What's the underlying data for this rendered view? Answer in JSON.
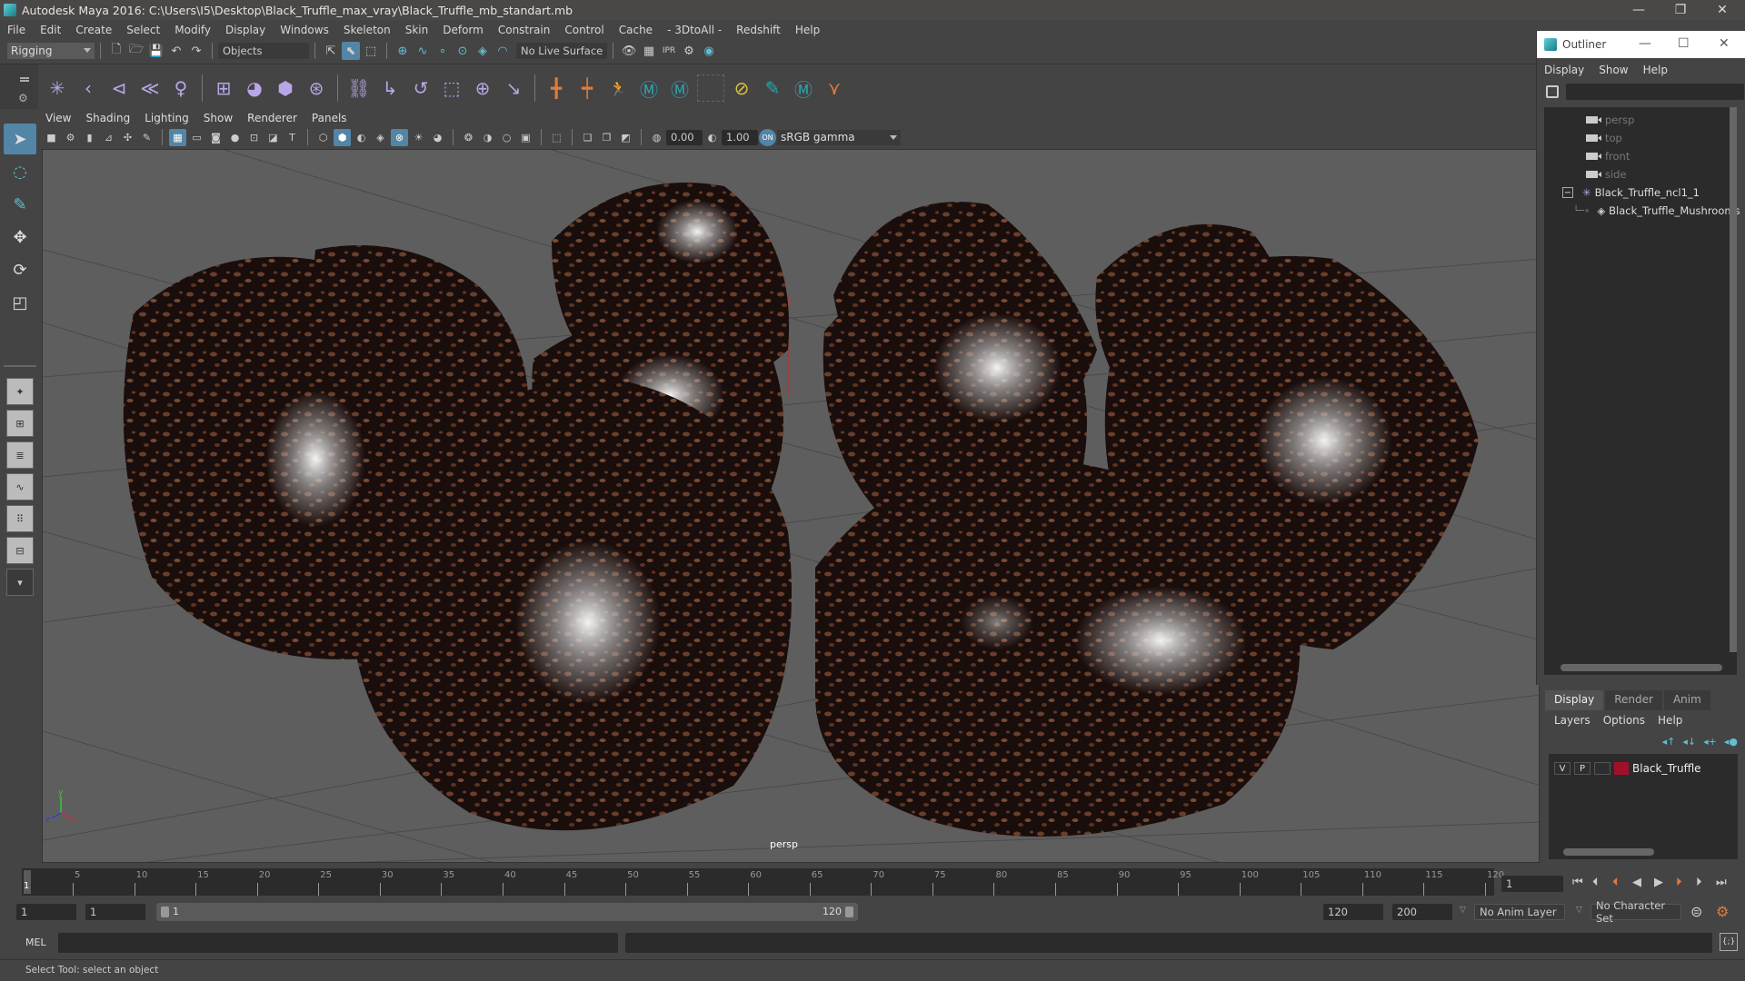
{
  "window": {
    "title": "Autodesk Maya 2016: C:\\Users\\I5\\Desktop\\Black_Truffle_max_vray\\Black_Truffle_mb_standart.mb",
    "controls": [
      "minimize",
      "restore",
      "close"
    ]
  },
  "menubar": [
    "File",
    "Edit",
    "Create",
    "Select",
    "Modify",
    "Display",
    "Windows",
    "Skeleton",
    "Skin",
    "Deform",
    "Constrain",
    "Control",
    "Cache",
    "- 3DtoAll -",
    "Redshift",
    "Help"
  ],
  "statusline": {
    "menuset": "Rigging",
    "selection_mode": "Objects",
    "live_surface": "No Live Surface"
  },
  "shelf": {
    "icons": [
      "joint-icon",
      "ik-handle-icon",
      "ik-spline-icon",
      "mirror-joint-icon",
      "humanik-icon",
      "bind-skin-icon",
      "smooth-bind-icon",
      "lattice-icon",
      "cluster-icon",
      "parent-constraint-icon",
      "point-constraint-icon",
      "orient-constraint-icon",
      "scale-constraint-icon",
      "aim-constraint-icon",
      "pole-vector-icon",
      "locator-icon",
      "locator-link-icon",
      "character-icon",
      "maya-icon-1",
      "maya-icon-2",
      "empty-slot",
      "delete-history-icon",
      "paint-weights-icon",
      "maya-icon-3",
      "vertex-icon"
    ]
  },
  "toolbox": {
    "tools": [
      "select-tool",
      "lasso-tool",
      "paint-select-tool",
      "move-tool",
      "rotate-tool",
      "scale-tool"
    ],
    "layouts": [
      "single-pane-layout",
      "four-pane-layout",
      "outliner-persp-layout",
      "graph-persp-layout",
      "hypershade-layout",
      "persp-graph-outliner-layout"
    ]
  },
  "viewport": {
    "menu": [
      "View",
      "Shading",
      "Lighting",
      "Show",
      "Renderer",
      "Panels"
    ],
    "exposure": "0.00",
    "gamma": "1.00",
    "color_space": "sRGB gamma",
    "camera": "persp",
    "axis": {
      "x": "x",
      "y": "y",
      "z": "z"
    }
  },
  "outliner": {
    "title": "Outliner",
    "menu": [
      "Display",
      "Show",
      "Help"
    ],
    "items": [
      {
        "label": "persp",
        "type": "camera",
        "dim": true
      },
      {
        "label": "top",
        "type": "camera",
        "dim": true
      },
      {
        "label": "front",
        "type": "camera",
        "dim": true
      },
      {
        "label": "side",
        "type": "camera",
        "dim": true
      },
      {
        "label": "Black_Truffle_ncl1_1",
        "type": "group",
        "expanded": true
      },
      {
        "label": "Black_Truffle_Mushrooms",
        "type": "mesh",
        "child": true
      }
    ]
  },
  "layer_editor": {
    "tabs": [
      "Display",
      "Render",
      "Anim"
    ],
    "active_tab": "Display",
    "menu": [
      "Layers",
      "Options",
      "Help"
    ],
    "layers": [
      {
        "visible": "V",
        "playback": "P",
        "name": "Black_Truffle",
        "color": "#a0102a"
      }
    ]
  },
  "timeline": {
    "ticks": [
      5,
      10,
      15,
      20,
      25,
      30,
      35,
      40,
      45,
      50,
      55,
      60,
      65,
      70,
      75,
      80,
      85,
      90,
      95,
      100,
      105,
      110,
      115,
      120
    ],
    "current_frame": "1",
    "frame_field": "1",
    "range_start": 1,
    "range_end": 120
  },
  "range": {
    "start_field": "1",
    "start_field2": "1",
    "slider_start": "1",
    "slider_end": "120",
    "end_field": "120",
    "end_field2": "200",
    "anim_layer": "No Anim Layer",
    "character_set": "No Character Set"
  },
  "cmdline": {
    "label": "MEL"
  },
  "helpline": {
    "text": "Select Tool: select an object"
  },
  "colors": {
    "accent": "#5285a6",
    "playback_marker": "#e07a3e",
    "viewport_bg": "#5e5e5e",
    "truffle_base": "#1a0e0c",
    "truffle_spots": "#7a4a32"
  }
}
